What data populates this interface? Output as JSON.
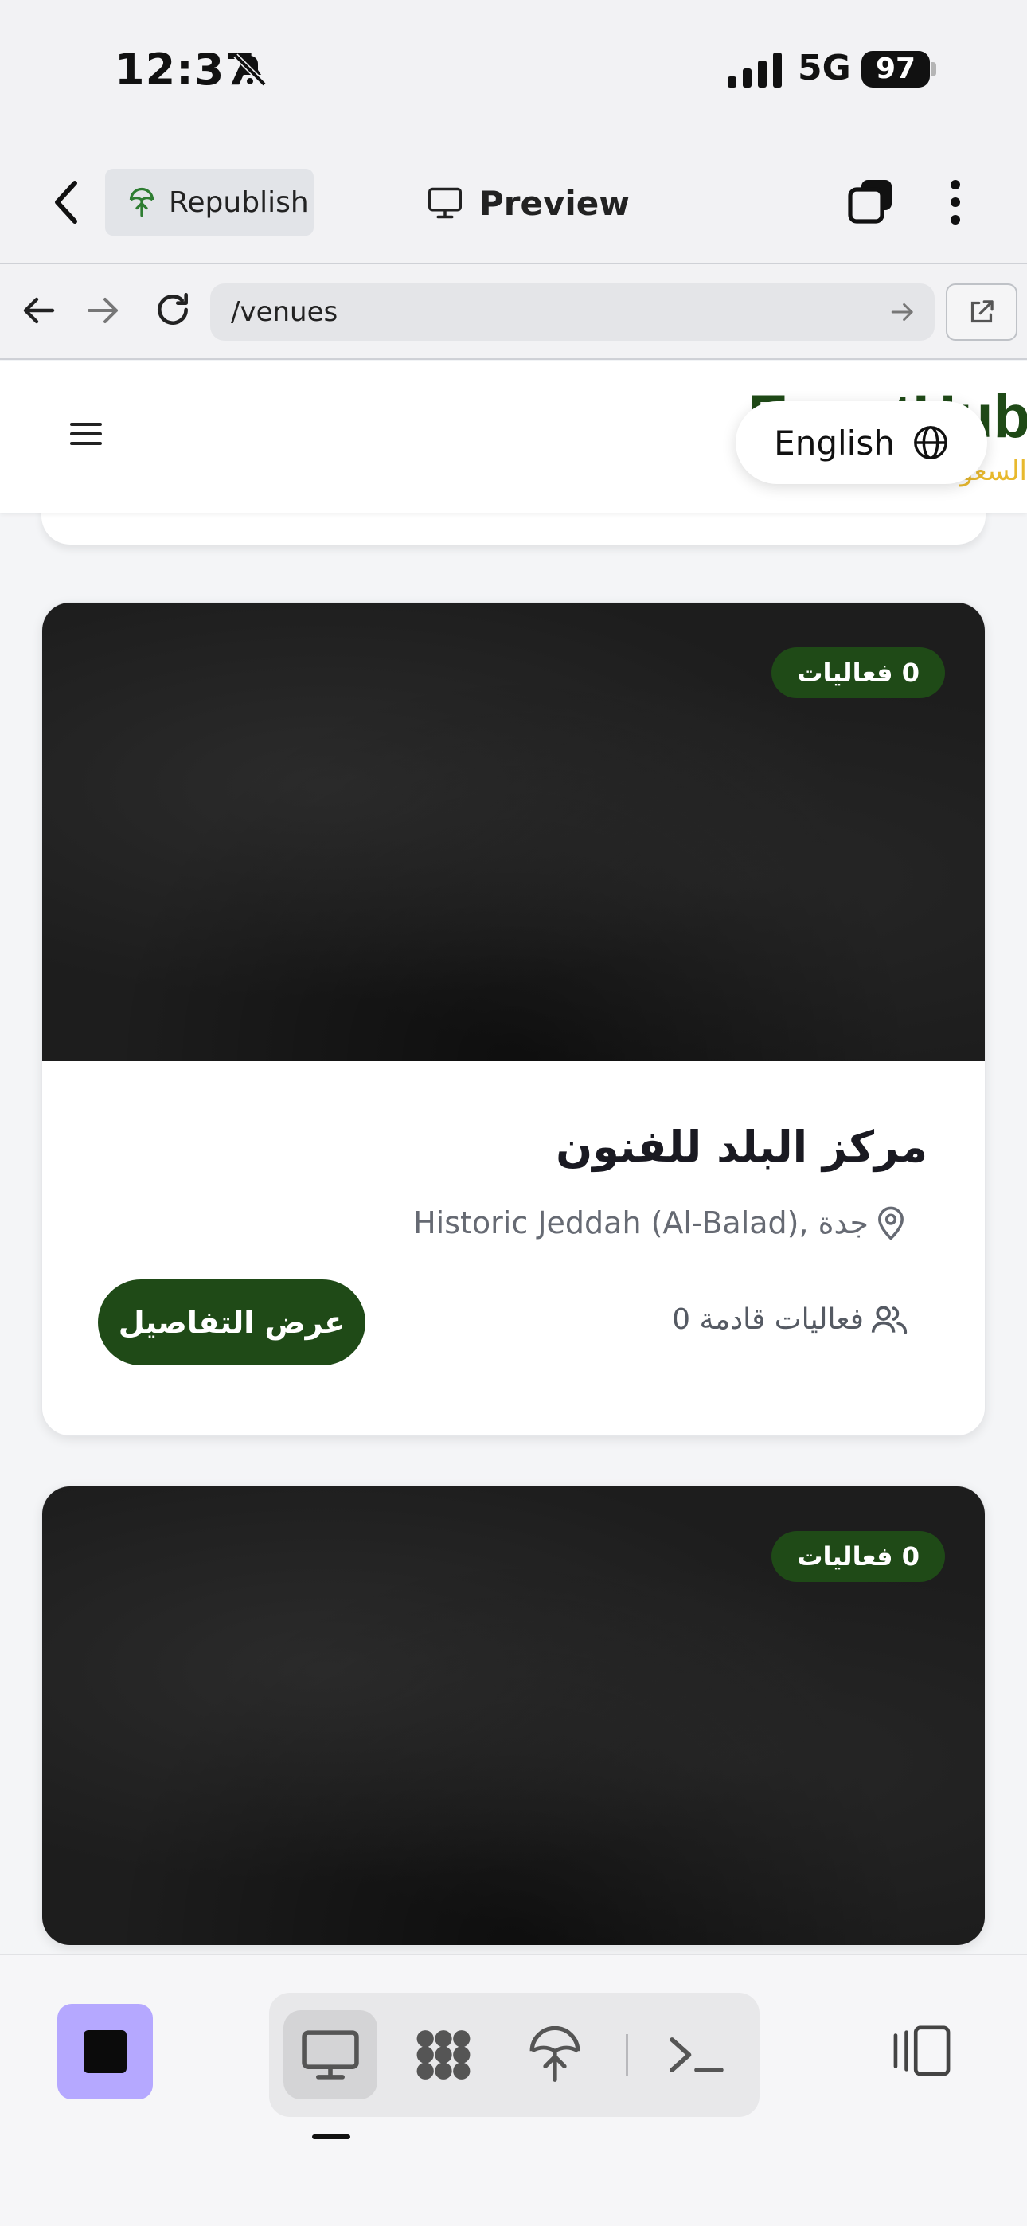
{
  "status_bar": {
    "time": "12:37",
    "network": "5G",
    "battery": "97"
  },
  "header": {
    "republish_label": "Republish",
    "preview_label": "Preview"
  },
  "browser": {
    "url": "/venues"
  },
  "site": {
    "brand": "EventHub",
    "brand_sub": "السعودية",
    "language_label": "English"
  },
  "venues": [
    {
      "badge": "0 فعاليات",
      "name": "مركز البلد للفنون",
      "location": "Historic Jeddah (Al-Balad), جدة",
      "upcoming": "0 فعاليات قادمة",
      "details_label": "عرض التفاصيل"
    },
    {
      "badge": "0 فعاليات"
    }
  ],
  "colors": {
    "brand_green": "#1f4a17",
    "brand_gold": "#e8b92e",
    "stop_purple": "#b5a8ff"
  },
  "icons": [
    "bell-slash-icon",
    "signal-icon",
    "back-icon",
    "republish-icon",
    "monitor-icon",
    "tabs-icon",
    "more-icon",
    "arrow-left-icon",
    "arrow-right-icon",
    "reload-icon",
    "external-link-icon",
    "menu-icon",
    "globe-icon",
    "map-pin-icon",
    "users-icon",
    "stop-icon",
    "grid-icon",
    "deploy-icon",
    "terminal-icon",
    "panel-icon"
  ]
}
